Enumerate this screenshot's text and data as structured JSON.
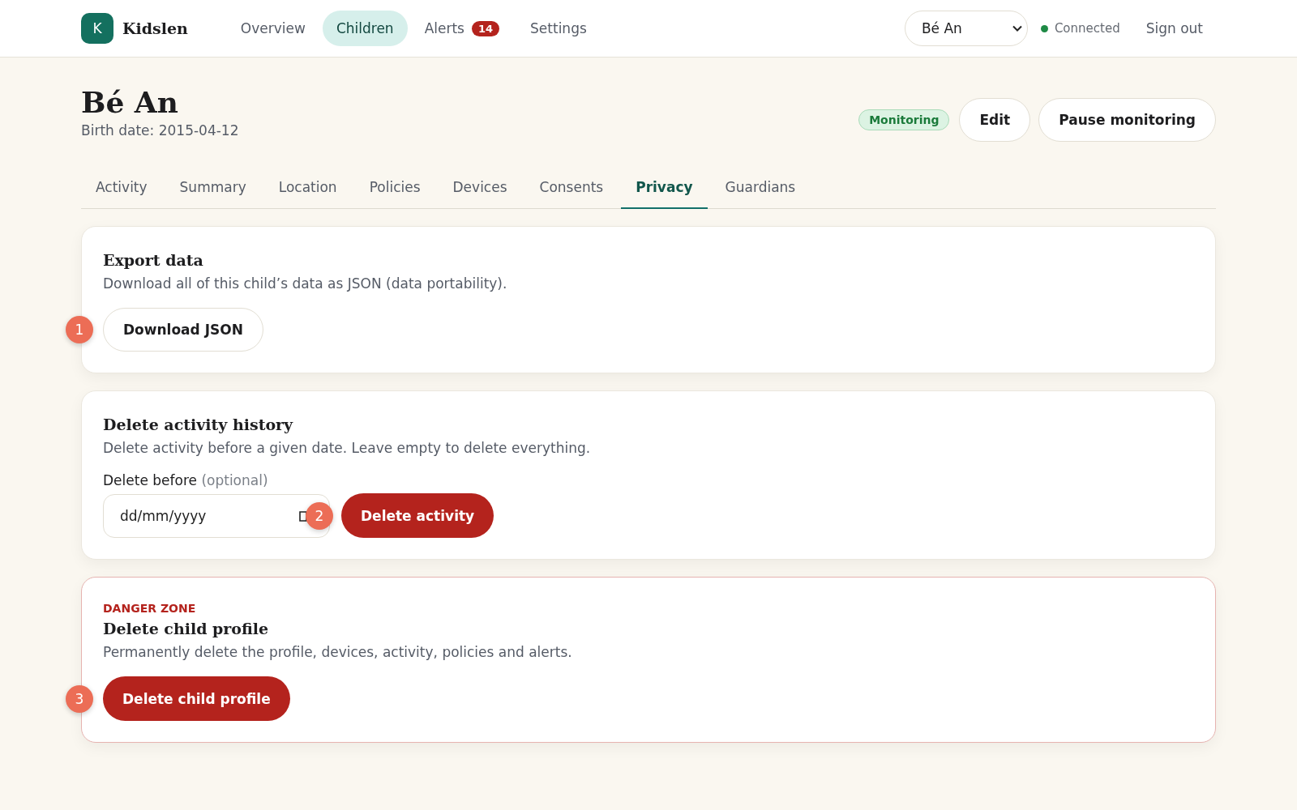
{
  "brand": {
    "initial": "K",
    "name": "Kidslen"
  },
  "nav": [
    {
      "label": "Overview",
      "selected": false
    },
    {
      "label": "Children",
      "selected": true
    },
    {
      "label": "Alerts",
      "selected": false,
      "badge": "14"
    },
    {
      "label": "Settings",
      "selected": false
    }
  ],
  "child_select": {
    "value": "Bé An"
  },
  "connection": {
    "label": "Connected",
    "color": "#1e8a45"
  },
  "sign_out": "Sign out",
  "profile": {
    "name": "Bé An",
    "birth_date": "Birth date: 2015-04-12",
    "status": "Monitoring",
    "actions": [
      "Edit",
      "Pause monitoring"
    ]
  },
  "tabs": [
    {
      "label": "Activity",
      "selected": false
    },
    {
      "label": "Summary",
      "selected": false
    },
    {
      "label": "Location",
      "selected": false
    },
    {
      "label": "Policies",
      "selected": false
    },
    {
      "label": "Devices",
      "selected": false
    },
    {
      "label": "Consents",
      "selected": false
    },
    {
      "label": "Privacy",
      "selected": true
    },
    {
      "label": "Guardians",
      "selected": false
    }
  ],
  "sections": [
    {
      "kind": "export",
      "title": "Export data",
      "description": "Download all of this child’s data as JSON (data portability).",
      "button": "Download JSON",
      "marker": "1"
    },
    {
      "kind": "delete_history",
      "title": "Delete activity history",
      "description": "Delete activity before a given date. Leave empty to delete everything.",
      "field_label": "Delete before",
      "field_hint": "(optional)",
      "placeholder": "dd/mm/yyyy",
      "button": "Delete activity",
      "marker": "2"
    },
    {
      "kind": "danger",
      "eyebrow": "DANGER ZONE",
      "title": "Delete child profile",
      "description": "Permanently delete the profile, devices, activity, policies and alerts.",
      "button": "Delete child profile",
      "marker": "3"
    }
  ]
}
